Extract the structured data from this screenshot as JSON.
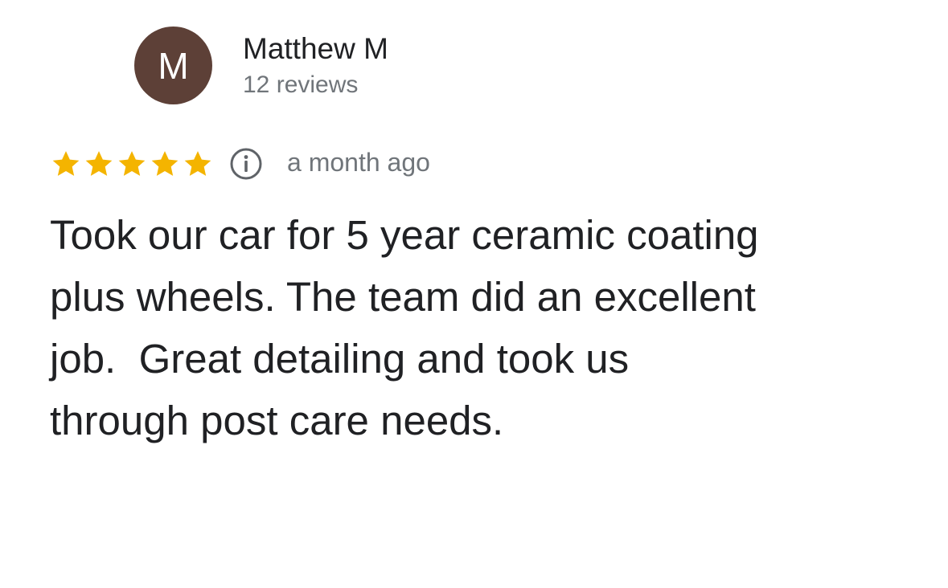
{
  "review": {
    "author": {
      "initial": "M",
      "name": "Matthew M",
      "reviews_count": "12 reviews",
      "avatar_color": "#5d4037"
    },
    "rating": 5,
    "rating_max": 5,
    "star_color": "#f4b400",
    "info_icon": "info-icon",
    "time": "a month ago",
    "text": "Took our car for 5 year ceramic coating\nplus wheels. The team did an excellent\njob.  Great detailing and took us\nthrough post care needs."
  }
}
